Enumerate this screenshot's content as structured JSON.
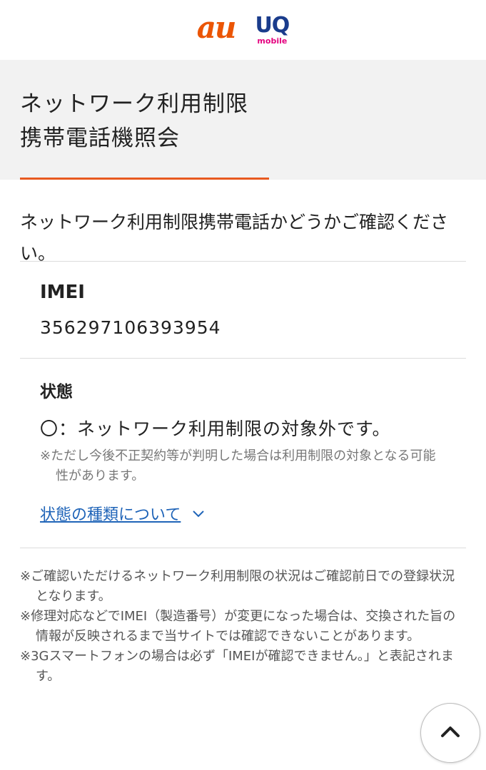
{
  "header": {
    "logo_au": "au",
    "logo_uq": "UQ",
    "logo_uq_sub": "mobile"
  },
  "title": {
    "line1": "ネットワーク利用制限",
    "line2": "携帯電話機照会"
  },
  "intro": "ネットワーク利用制限携帯電話かどうかご確認ください。",
  "imei": {
    "label": "IMEI",
    "value": "356297106393954"
  },
  "status": {
    "label": "状態",
    "text": "〇：ネットワーク利用制限の対象外です。",
    "note": "※ただし今後不正契約等が判明した場合は利用制限の対象となる可能性があります。",
    "link": "状態の種類について"
  },
  "notes": [
    "※ご確認いただけるネットワーク利用制限の状況はご確認前日での登録状況となります。",
    "※修理対応などでIMEI（製造番号）が変更になった場合は、交換された旨の情報が反映されるまで当サイトでは確認できないことがあります。",
    "※3Gスマートフォンの場合は必ず「IMEIが確認できません。」と表記されます。"
  ],
  "colors": {
    "au_orange": "#eb5505",
    "uq_blue": "#1a3c8c",
    "uq_pink": "#e4007f",
    "accent_underline": "#e85a20",
    "link_blue": "#1f64b8"
  },
  "icons": {
    "chevron": "chevron-down-icon",
    "scroll_top": "chevron-up-icon"
  }
}
